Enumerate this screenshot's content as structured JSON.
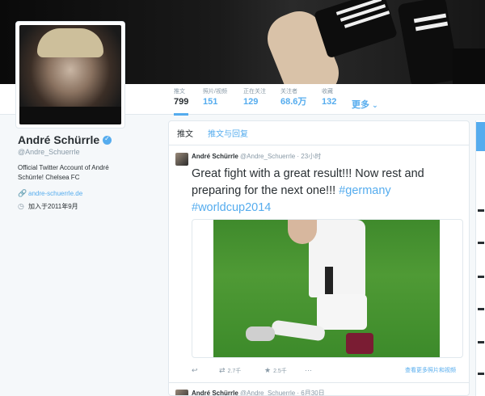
{
  "profile": {
    "name": "André Schürrle",
    "handle": "@Andre_Schuerrle",
    "bio": "Official Twitter Account of André Schürrle! Chelsea FC",
    "website": "andre-schuerrle.de",
    "joined": "加入于2011年9月"
  },
  "nav": {
    "stats": [
      {
        "label": "推文",
        "value": "799"
      },
      {
        "label": "照片/视频",
        "value": "151"
      },
      {
        "label": "正在关注",
        "value": "129"
      },
      {
        "label": "关注者",
        "value": "68.6万"
      },
      {
        "label": "收藏",
        "value": "132"
      }
    ],
    "more_label": "更多"
  },
  "timeline": {
    "tabs": [
      "推文",
      "推文与回复"
    ],
    "tweet": {
      "author": "André Schürrle",
      "handle": "@Andre_Schuerrle",
      "time": "· 23小时",
      "text": "Great fight with a great result!!! Now rest and preparing for the next one!!!",
      "hashtags": [
        "#germany",
        "#worldcup2014"
      ],
      "retweets": "2.7千",
      "favorites": "2.5千",
      "view_more": "查看更多照片和视频"
    },
    "next_tweet": {
      "author": "André Schürrle",
      "handle": "@Andre_Schuerrle",
      "time": "· 6月30日"
    }
  },
  "colors": {
    "accent": "#55acee",
    "text": "#292f33",
    "muted": "#8899a6"
  },
  "icons": [
    "verified-badge-icon",
    "link-icon",
    "calendar-icon",
    "reply-icon",
    "retweet-icon",
    "favorite-icon",
    "more-icon",
    "chevron-down-icon"
  ]
}
